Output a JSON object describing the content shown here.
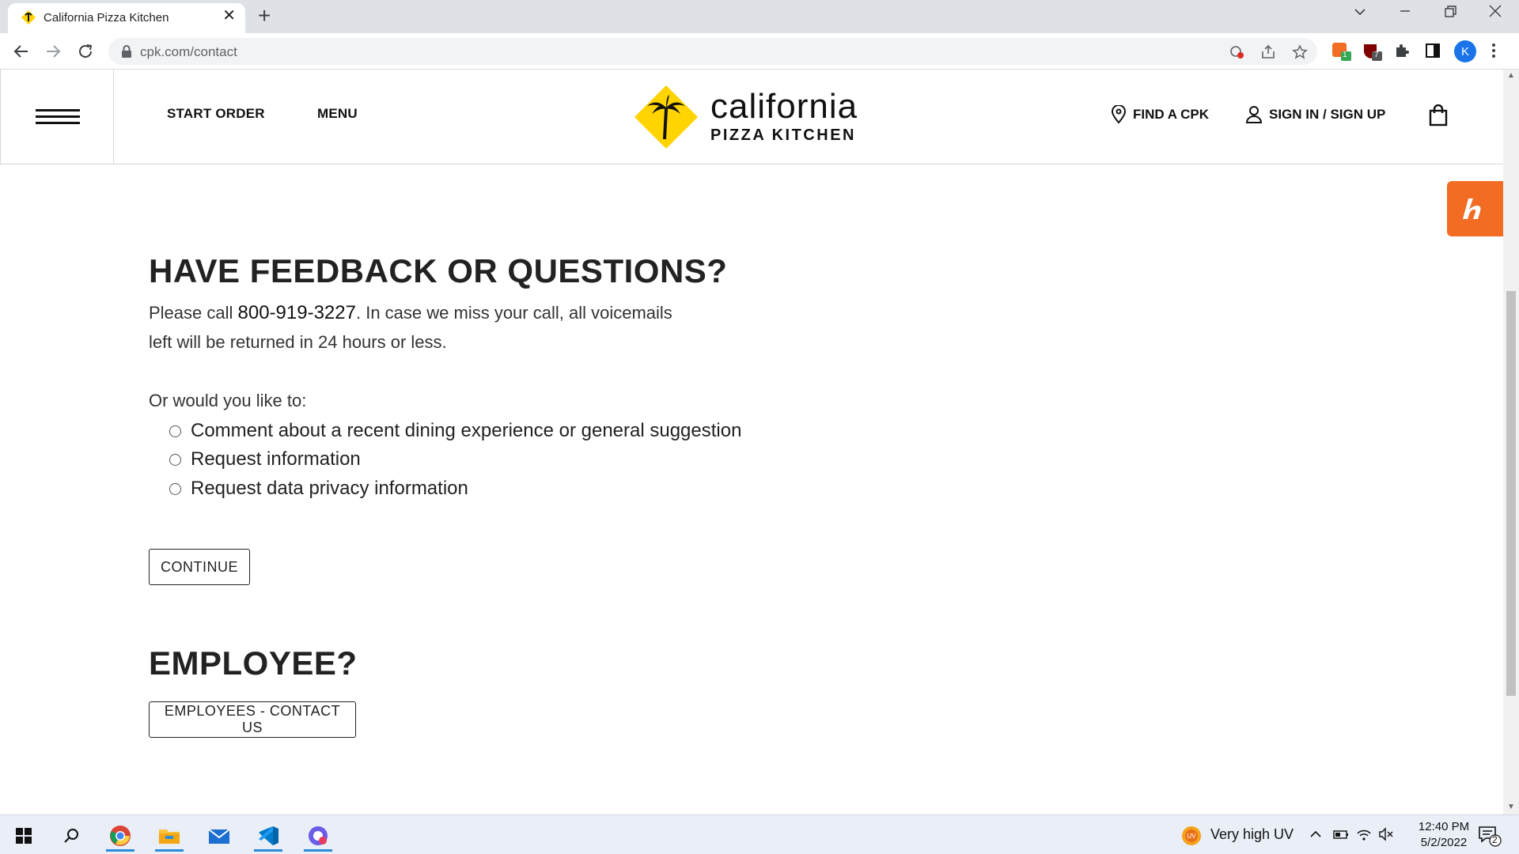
{
  "browser": {
    "tab_title": "California Pizza Kitchen",
    "tab_close": "✕",
    "new_tab": "+",
    "url": "cpk.com/contact",
    "profile_initial": "K",
    "ext_badge_1": "1",
    "ext_badge_2": "7"
  },
  "header": {
    "start_order": "START ORDER",
    "menu": "MENU",
    "logo_word1": "california",
    "logo_word2": "PIZZA KITCHEN",
    "find_cpk": "FIND A CPK",
    "sign_in": "SIGN IN / SIGN UP"
  },
  "feedback": {
    "heading": "HAVE FEEDBACK OR QUESTIONS?",
    "call_prefix": "Please call ",
    "phone": "800-919-3227",
    "call_suffix": ". In case we miss your call, all voicemails",
    "call_line2": "left will be returned in 24 hours or less.",
    "prompt": "Or would you like to:",
    "options": [
      "Comment about a recent dining experience or general suggestion",
      "Request information",
      "Request data privacy information"
    ],
    "continue_label": "CONTINUE"
  },
  "employee": {
    "heading": "EMPLOYEE?",
    "button_label": "EMPLOYEES - CONTACT US"
  },
  "taskbar": {
    "weather": "Very high UV",
    "time": "12:40 PM",
    "date": "5/2/2022",
    "notifications": "2"
  },
  "colors": {
    "brand_yellow": "#ffd400",
    "honey_orange": "#f26c23",
    "accent_blue": "#1a73e8"
  }
}
